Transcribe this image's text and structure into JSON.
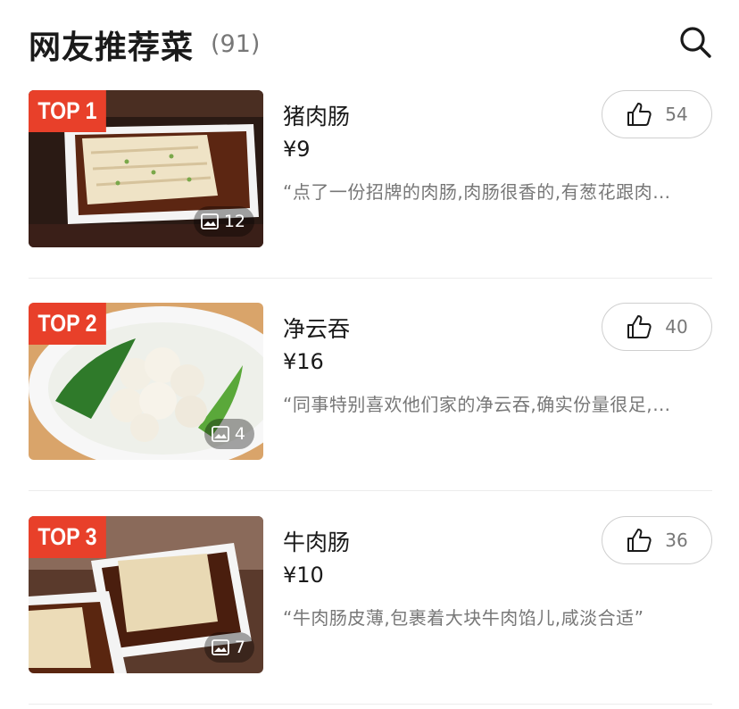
{
  "header": {
    "title": "网友推荐菜",
    "count": "(91)",
    "search_icon": "search-icon"
  },
  "dishes": [
    {
      "rank": "TOP 1",
      "name": "猪肉肠",
      "price": "¥9",
      "review": "“点了一份招牌的肉肠,肉肠很香的,有葱花跟肉…",
      "likes": "54",
      "photos": "12"
    },
    {
      "rank": "TOP 2",
      "name": "净云吞",
      "price": "¥16",
      "review": "“同事特别喜欢他们家的净云吞,确实份量很足,…",
      "likes": "40",
      "photos": "4"
    },
    {
      "rank": "TOP 3",
      "name": "牛肉肠",
      "price": "¥10",
      "review": "“牛肉肠皮薄,包裹着大块牛肉馅儿,咸淡合适”",
      "likes": "36",
      "photos": "7"
    }
  ],
  "colors": {
    "badge": "#e8402a",
    "text_primary": "#1a1a1a",
    "text_secondary": "#777777",
    "divider": "#ececec"
  }
}
